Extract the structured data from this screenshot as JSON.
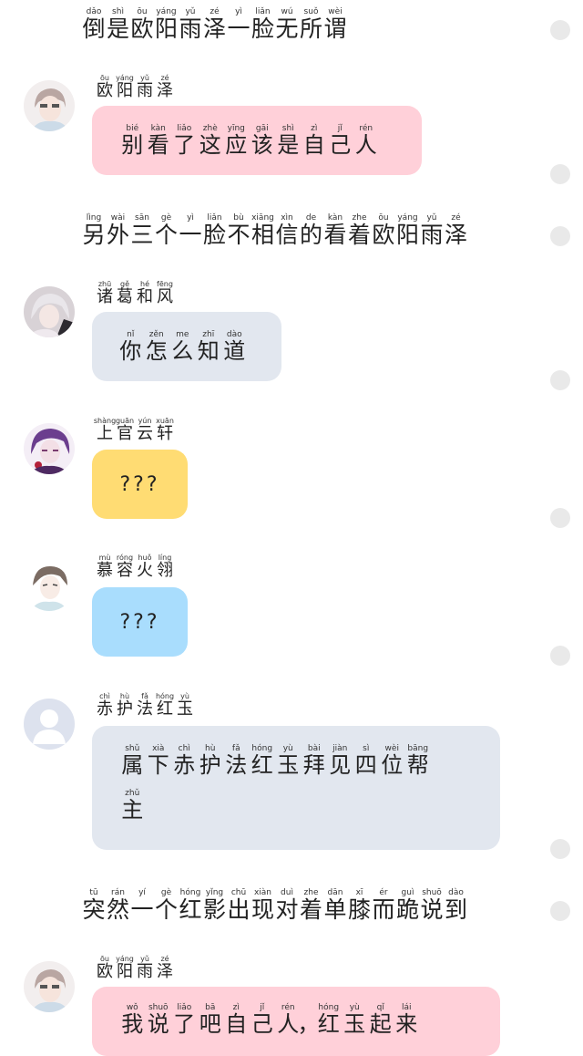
{
  "narrations": {
    "n1": [
      {
        "py": "dǎo",
        "hz": "倒"
      },
      {
        "py": "shì",
        "hz": "是"
      },
      {
        "py": "ōu",
        "hz": "欧"
      },
      {
        "py": "yáng",
        "hz": "阳"
      },
      {
        "py": "yǔ",
        "hz": "雨"
      },
      {
        "py": "zé",
        "hz": "泽"
      },
      {
        "py": "yì",
        "hz": "一"
      },
      {
        "py": "liǎn",
        "hz": "脸"
      },
      {
        "py": "wú",
        "hz": "无"
      },
      {
        "py": "suǒ",
        "hz": "所"
      },
      {
        "py": "wèi",
        "hz": "谓"
      }
    ],
    "n2": [
      {
        "py": "lìng",
        "hz": "另"
      },
      {
        "py": "wài",
        "hz": "外"
      },
      {
        "py": "sān",
        "hz": "三"
      },
      {
        "py": "gè",
        "hz": "个"
      },
      {
        "py": "yì",
        "hz": "一"
      },
      {
        "py": "liǎn",
        "hz": "脸"
      },
      {
        "py": "bù",
        "hz": "不"
      },
      {
        "py": "xiāng",
        "hz": "相"
      },
      {
        "py": "xìn",
        "hz": "信"
      },
      {
        "py": "de",
        "hz": "的"
      },
      {
        "py": "kàn",
        "hz": "看"
      },
      {
        "py": "zhe",
        "hz": "着"
      },
      {
        "py": "ōu",
        "hz": "欧"
      },
      {
        "py": "yáng",
        "hz": "阳"
      },
      {
        "py": "yǔ",
        "hz": "雨"
      },
      {
        "py": "zé",
        "hz": "泽"
      }
    ],
    "n3": [
      {
        "py": "tū",
        "hz": "突"
      },
      {
        "py": "rán",
        "hz": "然"
      },
      {
        "py": "yí",
        "hz": "一"
      },
      {
        "py": "gè",
        "hz": "个"
      },
      {
        "py": "hóng",
        "hz": "红"
      },
      {
        "py": "yǐng",
        "hz": "影"
      },
      {
        "py": "chū",
        "hz": "出"
      },
      {
        "py": "xiàn",
        "hz": "现"
      },
      {
        "py": "duì",
        "hz": "对"
      },
      {
        "py": "zhe",
        "hz": "着"
      },
      {
        "py": "dān",
        "hz": "单"
      },
      {
        "py": "xī",
        "hz": "膝"
      },
      {
        "py": "ér",
        "hz": "而"
      },
      {
        "py": "guì",
        "hz": "跪"
      },
      {
        "py": "shuō",
        "hz": "说"
      },
      {
        "py": "dào",
        "hz": "到"
      }
    ]
  },
  "messages": [
    {
      "speaker": [
        {
          "py": "ōu",
          "hz": "欧"
        },
        {
          "py": "yáng",
          "hz": "阳"
        },
        {
          "py": "yǔ",
          "hz": "雨"
        },
        {
          "py": "zé",
          "hz": "泽"
        }
      ],
      "text": [
        {
          "py": "bié",
          "hz": "别"
        },
        {
          "py": "kàn",
          "hz": "看"
        },
        {
          "py": "liǎo",
          "hz": "了"
        },
        {
          "py": "zhè",
          "hz": "这"
        },
        {
          "py": "yīng",
          "hz": "应"
        },
        {
          "py": "gāi",
          "hz": "该"
        },
        {
          "py": "shì",
          "hz": "是"
        },
        {
          "py": "zì",
          "hz": "自"
        },
        {
          "py": "jǐ",
          "hz": "己"
        },
        {
          "py": "rén",
          "hz": "人"
        }
      ]
    },
    {
      "speaker": [
        {
          "py": "zhū",
          "hz": "诸"
        },
        {
          "py": "gě",
          "hz": "葛"
        },
        {
          "py": "hé",
          "hz": "和"
        },
        {
          "py": "fēng",
          "hz": "风"
        }
      ],
      "text": [
        {
          "py": "nǐ",
          "hz": "你"
        },
        {
          "py": "zěn",
          "hz": "怎"
        },
        {
          "py": "me",
          "hz": "么"
        },
        {
          "py": "zhī",
          "hz": "知"
        },
        {
          "py": "dào",
          "hz": "道"
        }
      ]
    },
    {
      "speaker": [
        {
          "py": "shàng",
          "hz": "上"
        },
        {
          "py": "guān",
          "hz": "官"
        },
        {
          "py": "yún",
          "hz": "云"
        },
        {
          "py": "xuān",
          "hz": "轩"
        }
      ],
      "text_plain": "???"
    },
    {
      "speaker": [
        {
          "py": "mù",
          "hz": "慕"
        },
        {
          "py": "róng",
          "hz": "容"
        },
        {
          "py": "huǒ",
          "hz": "火"
        },
        {
          "py": "líng",
          "hz": "翎"
        }
      ],
      "text_plain": "???"
    },
    {
      "speaker": [
        {
          "py": "chì",
          "hz": "赤"
        },
        {
          "py": "hù",
          "hz": "护"
        },
        {
          "py": "fǎ",
          "hz": "法"
        },
        {
          "py": "hóng",
          "hz": "红"
        },
        {
          "py": "yù",
          "hz": "玉"
        }
      ],
      "text": [
        {
          "py": "shǔ",
          "hz": "属"
        },
        {
          "py": "xià",
          "hz": "下"
        },
        {
          "py": "chì",
          "hz": "赤"
        },
        {
          "py": "hù",
          "hz": "护"
        },
        {
          "py": "fǎ",
          "hz": "法"
        },
        {
          "py": "hóng",
          "hz": "红"
        },
        {
          "py": "yù",
          "hz": "玉"
        },
        {
          "py": "bài",
          "hz": "拜"
        },
        {
          "py": "jiàn",
          "hz": "见"
        },
        {
          "py": "sì",
          "hz": "四"
        },
        {
          "py": "wèi",
          "hz": "位"
        },
        {
          "py": "bāng",
          "hz": "帮"
        },
        {
          "py": "zhǔ",
          "hz": "主"
        }
      ]
    },
    {
      "speaker": [
        {
          "py": "ōu",
          "hz": "欧"
        },
        {
          "py": "yáng",
          "hz": "阳"
        },
        {
          "py": "yǔ",
          "hz": "雨"
        },
        {
          "py": "zé",
          "hz": "泽"
        }
      ],
      "text": [
        {
          "py": "wǒ",
          "hz": "我"
        },
        {
          "py": "shuō",
          "hz": "说"
        },
        {
          "py": "liǎo",
          "hz": "了"
        },
        {
          "py": "bā",
          "hz": "吧"
        },
        {
          "py": "zì",
          "hz": "自"
        },
        {
          "py": "jǐ",
          "hz": "己"
        },
        {
          "py": "rén",
          "hz": "人"
        },
        {
          "py": "",
          "hz": "，"
        },
        {
          "py": "hóng",
          "hz": "红"
        },
        {
          "py": "yù",
          "hz": "玉"
        },
        {
          "py": "qǐ",
          "hz": "起"
        },
        {
          "py": "lái",
          "hz": "来"
        }
      ]
    }
  ],
  "colors": {
    "pink_bubble": "#ffd0d9",
    "gray_bubble": "#e2e7ef",
    "yellow_bubble": "#ffdc73",
    "blue_bubble": "#a9ddfd",
    "scroll_dot": "#e9e9e9"
  }
}
